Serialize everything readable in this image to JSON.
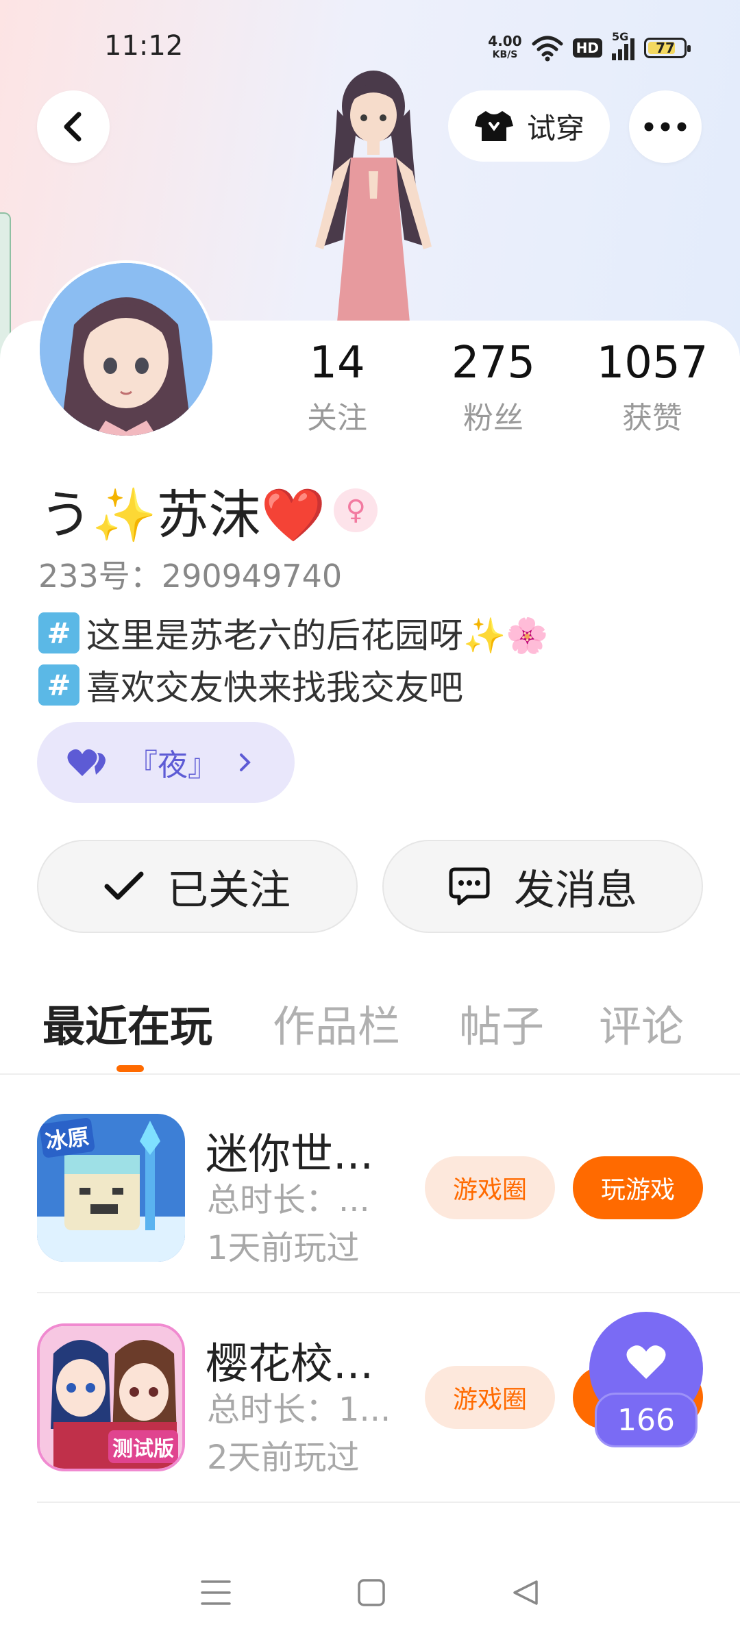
{
  "status_bar": {
    "time": "11:12",
    "net_speed_value": "4.00",
    "net_speed_unit": "KB/S",
    "hd_label": "HD",
    "network_label": "5G",
    "battery_level": "77"
  },
  "header": {
    "try_on_label": "试穿"
  },
  "profile": {
    "stats": [
      {
        "value": "14",
        "label": "关注"
      },
      {
        "value": "275",
        "label": "粉丝"
      },
      {
        "value": "1057",
        "label": "获赞"
      }
    ],
    "name": "う✨苏沫❤️",
    "gender_symbol": "♀",
    "uid": "233号：290949740",
    "bio_lines": [
      "这里是苏老六的后花园呀✨🌸",
      "喜欢交友快来找我交友吧"
    ],
    "hash_symbol": "#",
    "cp_tag_label": "『夜』",
    "follow_button_label": "已关注",
    "message_button_label": "发消息"
  },
  "tabs": [
    {
      "label": "最近在玩",
      "active": true
    },
    {
      "label": "作品栏",
      "active": false
    },
    {
      "label": "帖子",
      "active": false
    },
    {
      "label": "评论",
      "active": false
    }
  ],
  "games": [
    {
      "title": "迷你世...",
      "duration": "总时长：...",
      "last_played": "1天前玩过",
      "icon_badge": "冰原",
      "circle_label": "游戏圈",
      "play_label": "玩游戏"
    },
    {
      "title": "樱花校...",
      "duration": "总时长：1...",
      "last_played": "2天前玩过",
      "icon_badge": "测试版",
      "circle_label": "游戏圈",
      "play_label": "玩游戏"
    }
  ],
  "like_float": {
    "count": "166"
  },
  "colors": {
    "accent_orange": "#ff6a00",
    "accent_purple": "#7a6bf4",
    "cp_tag_bg": "#e9e7fb"
  }
}
